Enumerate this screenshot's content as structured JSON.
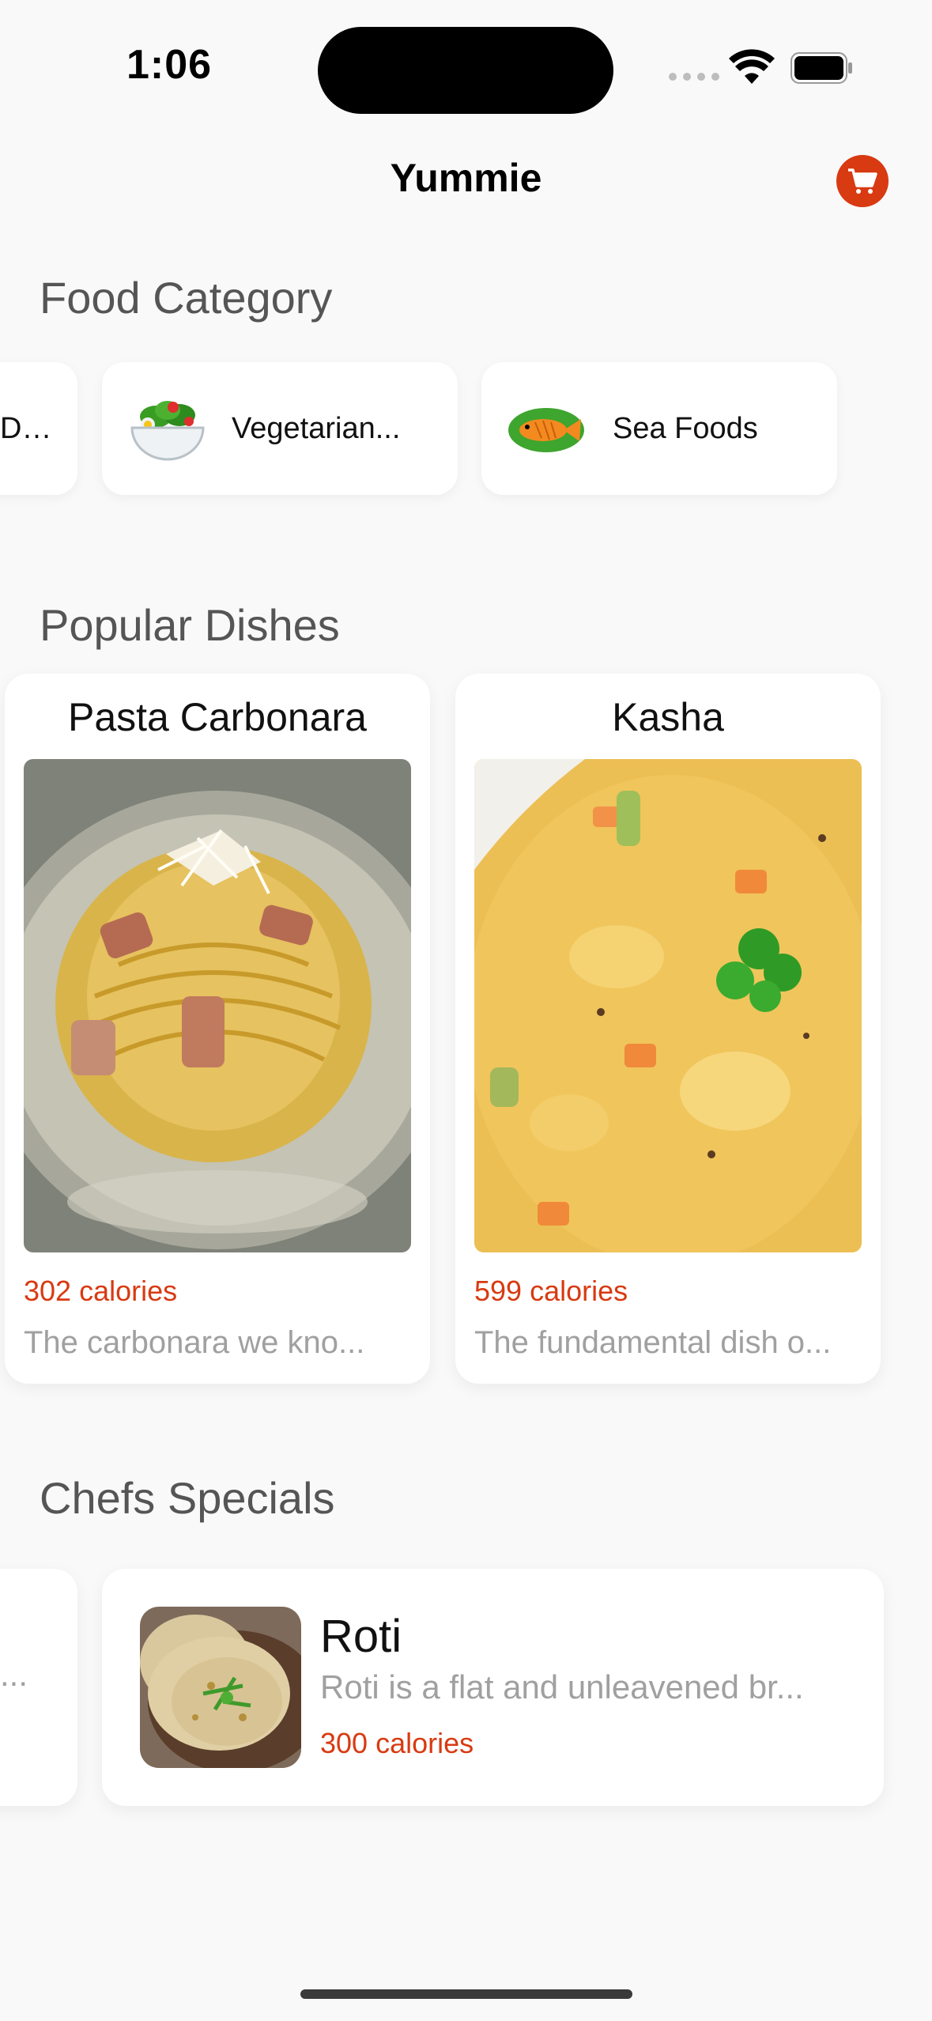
{
  "status_bar": {
    "time": "1:06"
  },
  "nav": {
    "title": "Yummie",
    "cart_icon": "cart-icon"
  },
  "sections": {
    "categories": "Food Category",
    "popular": "Popular Dishes",
    "specials": "Chefs Specials"
  },
  "categories": [
    {
      "label": "Dis...",
      "icon": "partial"
    },
    {
      "label": "Vegetarian...",
      "icon": "salad-bowl-icon"
    },
    {
      "label": "Sea Foods",
      "icon": "fish-icon"
    }
  ],
  "popular_dishes": [
    {
      "name": "Pasta Carbonara",
      "calories": "302 calories",
      "description": "The carbonara we kno..."
    },
    {
      "name": "Kasha",
      "calories": "599 calories",
      "description": "The fundamental dish o..."
    }
  ],
  "chefs_specials": [
    {
      "partial_text": "..."
    },
    {
      "name": "Roti",
      "description": "Roti is a flat and unleavened br...",
      "calories": "300 calories"
    }
  ],
  "colors": {
    "accent": "#d83a12",
    "background": "#f9f9f9",
    "card": "#ffffff",
    "muted_text": "#a0a0a0",
    "section_title": "#555555"
  }
}
